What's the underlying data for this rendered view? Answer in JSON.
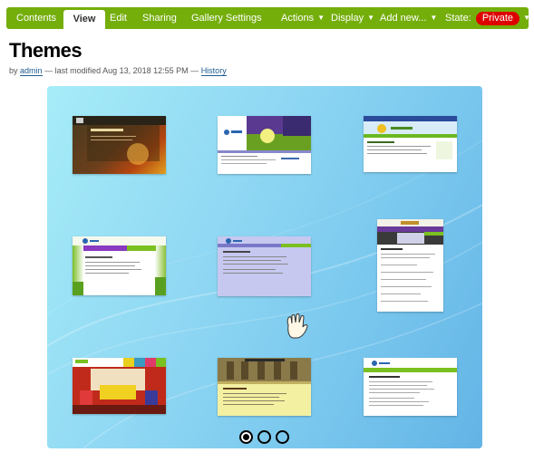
{
  "editbar": {
    "contents_label": "Contents",
    "view_label": "View",
    "edit_label": "Edit",
    "sharing_label": "Sharing",
    "gallery_settings_label": "Gallery Settings",
    "actions_label": "Actions",
    "display_label": "Display",
    "add_new_label": "Add new...",
    "state_label": "State:",
    "state_value": "Private",
    "caret_icon": "chevron-down-icon"
  },
  "page": {
    "title": "Themes",
    "by": "by",
    "author": "admin",
    "modified_text": "— last modified Aug 13, 2018 12:55 PM —",
    "history_label": "History"
  },
  "gallery": {
    "slides_count": 3,
    "active_slide": 1,
    "cursor_icon": "hand-cursor-icon",
    "thumbnails": [
      {
        "name": "theme-dark-autumn",
        "header": "Welcome to Plone",
        "style": "dark"
      },
      {
        "name": "theme-purple-landscape",
        "header": "Plone",
        "style": "purple"
      },
      {
        "name": "theme-blue-green",
        "header": "Welcome to Plone",
        "style": "bluegreen"
      },
      {
        "name": "theme-green-leaves",
        "header": "Welcome to Plone",
        "style": "leaves"
      },
      {
        "name": "theme-lavender",
        "header": "Welcome to Plone",
        "style": "lavender"
      },
      {
        "name": "theme-tall-purple",
        "header": "Welcome to Plone",
        "style": "tall"
      },
      {
        "name": "theme-colorful-room",
        "header": "Welcome to Plone",
        "style": "room"
      },
      {
        "name": "theme-yellow-vintage",
        "header": "Welcome to Plone",
        "style": "vintage"
      },
      {
        "name": "theme-clean-green",
        "header": "Welcome to Plone",
        "style": "clean"
      }
    ]
  }
}
